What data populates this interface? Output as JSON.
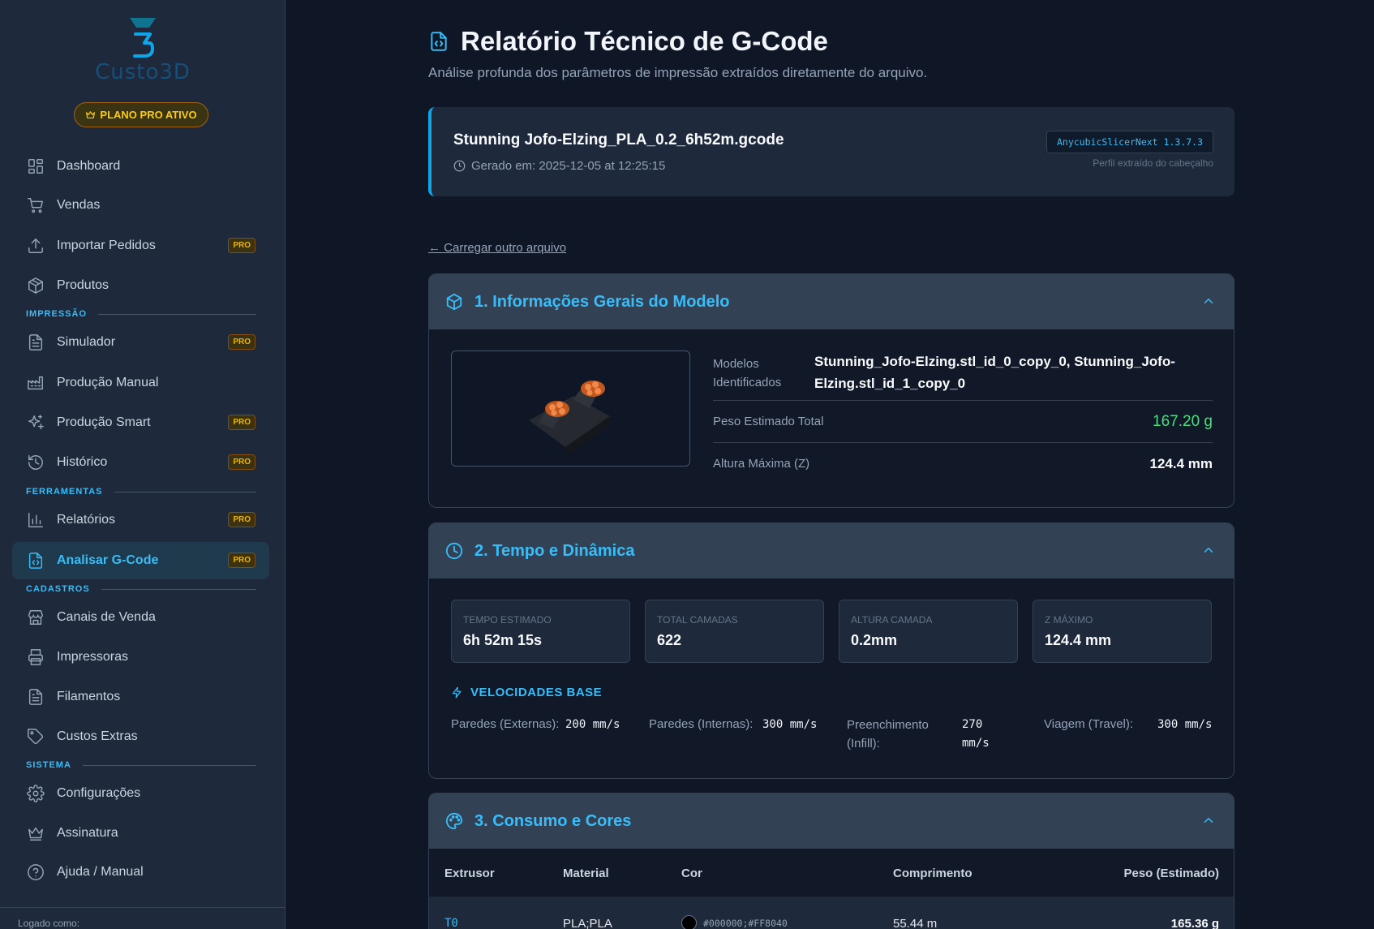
{
  "sidebar": {
    "logo_text": "Custo3D",
    "plan_badge": "PLANO PRO ATIVO",
    "pro_label": "PRO",
    "sections": {
      "impressao": "IMPRESSÃO",
      "ferramentas": "FERRAMENTAS",
      "cadastros": "CADASTROS",
      "sistema": "SISTEMA"
    },
    "items": [
      {
        "label": "Dashboard",
        "icon": "dashboard-icon"
      },
      {
        "label": "Vendas",
        "icon": "cart-icon"
      },
      {
        "label": "Importar Pedidos",
        "icon": "upload-icon",
        "pro": true
      },
      {
        "label": "Produtos",
        "icon": "box-icon"
      },
      {
        "label": "Simulador",
        "icon": "document-icon",
        "pro": true
      },
      {
        "label": "Produção Manual",
        "icon": "factory-icon"
      },
      {
        "label": "Produção Smart",
        "icon": "sparkles-icon",
        "pro": true
      },
      {
        "label": "Histórico",
        "icon": "history-icon",
        "pro": true
      },
      {
        "label": "Relatórios",
        "icon": "bar-chart-icon",
        "pro": true
      },
      {
        "label": "Analisar G-Code",
        "icon": "code-file-icon",
        "pro": true,
        "active": true
      },
      {
        "label": "Canais de Venda",
        "icon": "store-icon"
      },
      {
        "label": "Impressoras",
        "icon": "printer-icon"
      },
      {
        "label": "Filamentos",
        "icon": "document-icon"
      },
      {
        "label": "Custos Extras",
        "icon": "tag-icon"
      },
      {
        "label": "Configurações",
        "icon": "gear-icon"
      },
      {
        "label": "Assinatura",
        "icon": "crown-icon"
      },
      {
        "label": "Ajuda / Manual",
        "icon": "help-icon"
      }
    ],
    "footer": "Logado como:"
  },
  "page": {
    "title": "Relatório Técnico de G-Code",
    "subtitle": "Análise profunda dos parâmetros de impressão extraídos diretamente do arquivo."
  },
  "file": {
    "name": "Stunning Jofo-Elzing_PLA_0.2_6h52m.gcode",
    "generated": "Gerado em: 2025-12-05 at 12:25:15",
    "slicer": "AnycubicSlicerNext 1.3.7.3",
    "slicer_note": "Perfil extraído do cabeçalho"
  },
  "back_link": "← Carregar outro arquivo",
  "model_info": {
    "title": "1. Informações Gerais do Modelo",
    "models_label_1": "Modelos",
    "models_label_2": "Identificados",
    "models_value_1": "Stunning_Jofo-Elzing.stl_id_0_copy_0, Stunning_Jofo-",
    "models_value_2": "Elzing.stl_id_1_copy_0",
    "weight_label": "Peso Estimado Total",
    "weight_value": "167.20 g",
    "height_label": "Altura Máxima (Z)",
    "height_value": "124.4 mm"
  },
  "time": {
    "title": "2. Tempo e Dinâmica",
    "stats": [
      {
        "label": "TEMPO ESTIMADO",
        "value": "6h 52m 15s"
      },
      {
        "label": "TOTAL CAMADAS",
        "value": "622"
      },
      {
        "label": "ALTURA CAMADA",
        "value": "0.2mm"
      },
      {
        "label": "Z MÁXIMO",
        "value": "124.4 mm"
      }
    ],
    "speeds_title": "VELOCIDADES BASE",
    "speeds": [
      {
        "label": "Paredes (Externas):",
        "value": "200 mm/s"
      },
      {
        "label": "Paredes (Internas):",
        "value": "300 mm/s"
      },
      {
        "label_1": "Preenchimento",
        "label_2": "(Infill):",
        "value_1": "270",
        "value_2": "mm/s"
      },
      {
        "label": "Viagem (Travel):",
        "value": "300 mm/s"
      }
    ]
  },
  "consumption": {
    "title": "3. Consumo e Cores",
    "headers": [
      "Extrusor",
      "Material",
      "Cor",
      "Comprimento",
      "Peso (Estimado)"
    ],
    "rows": [
      {
        "extruder": "T0",
        "material": "PLA;PLA",
        "color": "#000000;#FF8040",
        "length": "55.44 m",
        "weight": "165.36 g"
      }
    ]
  },
  "colors": {
    "accent": "#38bdf8",
    "pro": "#eab308",
    "success": "#4ade80"
  }
}
